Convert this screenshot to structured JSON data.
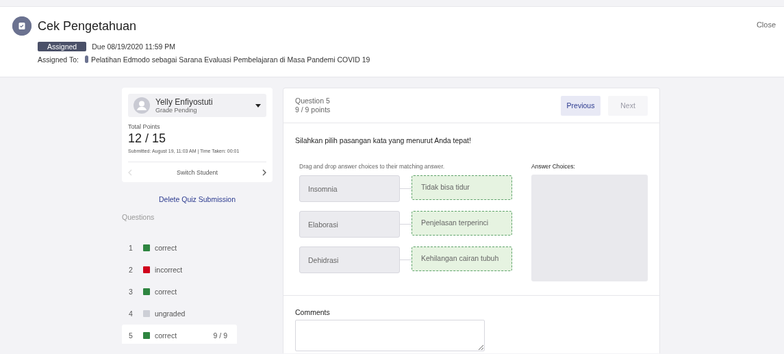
{
  "header": {
    "title": "Cek Pengetahuan",
    "status_badge": "Assigned",
    "due": "Due 08/19/2020 11:59 PM",
    "assigned_to_label": "Assigned To:",
    "assigned_to": "Pelatihan Edmodo sebagai Sarana Evaluasi Pembelajaran di Masa Pandemi COVID 19",
    "close": "Close"
  },
  "student": {
    "name": "Yelly Enfiyostuti",
    "status": "Grade Pending",
    "total_label": "Total Points",
    "total": "12 / 15",
    "submitted": "Submitted: August 19, 11:03 AM | Time Taken: 00:01",
    "switch_label": "Switch Student"
  },
  "delete_link": "Delete Quiz Submission",
  "questions_label": "Questions",
  "questions": [
    {
      "number": "1",
      "status": "correct",
      "color": "#2e8540",
      "selected": false
    },
    {
      "number": "2",
      "status": "incorrect",
      "color": "#d0021b",
      "selected": false
    },
    {
      "number": "3",
      "status": "correct",
      "color": "#2e8540",
      "selected": false
    },
    {
      "number": "4",
      "status": "ungraded",
      "color": "#cdcfd6",
      "selected": false
    },
    {
      "number": "5",
      "status": "correct",
      "color": "#2e8540",
      "selected": true,
      "score": "9 / 9"
    }
  ],
  "question": {
    "title": "Question 5",
    "points": "9 / 9 points",
    "previous": {
      "label": "Previous",
      "disabled": false
    },
    "next": {
      "label": "Next",
      "disabled": true
    },
    "prompt": "Silahkan pilih pasangan kata yang menurut Anda tepat!",
    "instruction": "Drag and drop answer choices to their matching answer.",
    "choices_label": "Answer Choices:",
    "pairs": [
      {
        "term": "Insomnia",
        "answer": "Tidak bisa tidur"
      },
      {
        "term": "Elaborasi",
        "answer": "Penjelasan terperinci"
      },
      {
        "term": "Dehidrasi",
        "answer": "Kehilangan cairan tubuh"
      }
    ],
    "comments_label": "Comments"
  }
}
